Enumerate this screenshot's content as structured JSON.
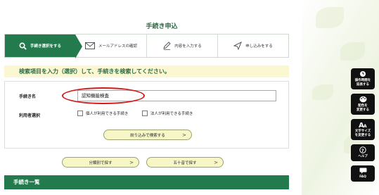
{
  "page": {
    "title": "手続き申込"
  },
  "steps": [
    {
      "label": "手続き選択をする",
      "icon": "search-icon",
      "active": true
    },
    {
      "label": "メールアドレスの確認",
      "icon": "mail-icon",
      "active": false
    },
    {
      "label": "内容を入力する",
      "icon": "pencil-icon",
      "active": false
    },
    {
      "label": "申し込みをする",
      "icon": "send-icon",
      "active": false
    }
  ],
  "search": {
    "heading": "検索項目を入力（選択）して、手続きを検索してください。",
    "name_label": "手続き名",
    "name_value": "認知機能検査",
    "user_label": "利用者選択",
    "individual_label": "個人が利用できる手続き",
    "corporate_label": "法人が利用できる手続き",
    "filter_button": "絞り込みで検索する",
    "chevron": ">"
  },
  "browse": {
    "category_button": "分類別で探す",
    "kana_button": "五十音で探す"
  },
  "list": {
    "heading": "手続き一覧"
  },
  "sidebar": {
    "items": [
      {
        "label1": "操作時間を",
        "label2": "延長する",
        "icon": "clock-icon"
      },
      {
        "label1": "配色を",
        "label2": "変更する",
        "icon": "palette-icon"
      },
      {
        "label1": "文字サイズ",
        "label2": "を変更する",
        "icon": "text-size-icon"
      },
      {
        "label1": "ヘルプ",
        "label2": "",
        "icon": "help-icon"
      },
      {
        "label1": "FAQ",
        "label2": "",
        "icon": "faq-icon"
      }
    ]
  },
  "colors": {
    "accent": "#237a4d",
    "highlight": "#d01c1c",
    "banner": "#fbf7d0"
  }
}
